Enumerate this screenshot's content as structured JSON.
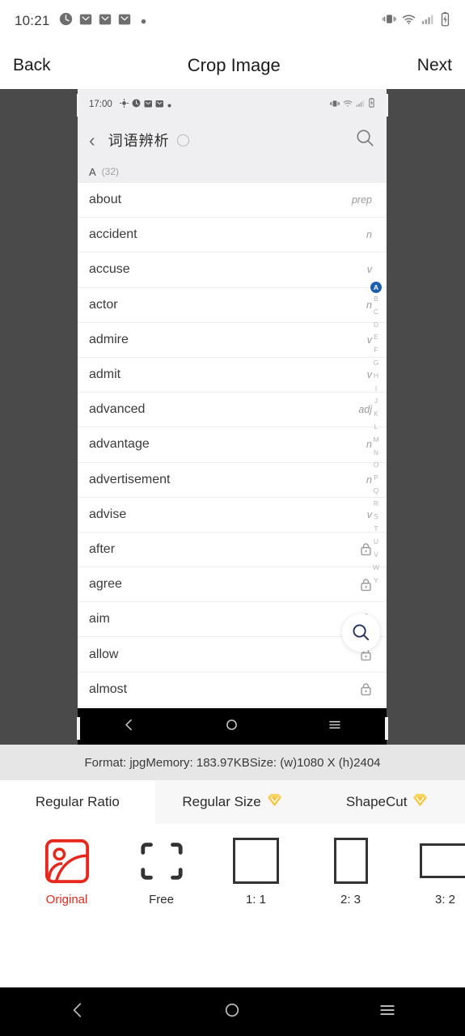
{
  "status_bar": {
    "time": "10:21",
    "left_icons": [
      "clock-icon",
      "mail-icon",
      "mail-icon",
      "mail-icon",
      "dot-icon"
    ],
    "right_icons": [
      "vibrate-icon",
      "wifi-icon",
      "signal-icon",
      "battery-charging-icon"
    ]
  },
  "app_bar": {
    "back_label": "Back",
    "title": "Crop Image",
    "next_label": "Next"
  },
  "preview": {
    "inner_status": {
      "time": "17:00",
      "left_icons": [
        "location-icon",
        "clock-icon",
        "mail-icon",
        "mail-icon",
        "dot-icon"
      ],
      "right_icons": [
        "vibrate-icon",
        "wifi-icon",
        "signal-icon",
        "battery-icon"
      ]
    },
    "inner_title": "词语辨析",
    "section": {
      "letter": "A",
      "count": "(32)"
    },
    "words": [
      {
        "word": "about",
        "pos": "prep",
        "locked": false
      },
      {
        "word": "accident",
        "pos": "n",
        "locked": false
      },
      {
        "word": "accuse",
        "pos": "v",
        "locked": false
      },
      {
        "word": "actor",
        "pos": "n",
        "locked": false
      },
      {
        "word": "admire",
        "pos": "v",
        "locked": false
      },
      {
        "word": "admit",
        "pos": "v",
        "locked": false
      },
      {
        "word": "advanced",
        "pos": "adj",
        "locked": false
      },
      {
        "word": "advantage",
        "pos": "n",
        "locked": false
      },
      {
        "word": "advertisement",
        "pos": "n",
        "locked": false
      },
      {
        "word": "advise",
        "pos": "v",
        "locked": false
      },
      {
        "word": "after",
        "pos": "",
        "locked": true
      },
      {
        "word": "agree",
        "pos": "",
        "locked": true
      },
      {
        "word": "aim",
        "pos": "",
        "locked": true
      },
      {
        "word": "allow",
        "pos": "",
        "locked": true
      },
      {
        "word": "almost",
        "pos": "",
        "locked": true
      }
    ],
    "alphabet": [
      "A",
      "B",
      "C",
      "D",
      "E",
      "F",
      "G",
      "H",
      "I",
      "J",
      "K",
      "L",
      "M",
      "N",
      "O",
      "P",
      "Q",
      "R",
      "S",
      "T",
      "U",
      "V",
      "W",
      "Y"
    ],
    "alphabet_active": "A",
    "fab_icon": "search-icon",
    "nav_icons": [
      "back-icon",
      "home-icon",
      "recents-icon"
    ]
  },
  "info_bar": {
    "text": "Format: jpgMemory: 183.97KBSize: (w)1080 X (h)2404"
  },
  "tabs": [
    {
      "label": "Regular Ratio",
      "active": true,
      "vip": false
    },
    {
      "label": "Regular Size",
      "active": false,
      "vip": true
    },
    {
      "label": "ShapeCut",
      "active": false,
      "vip": true
    }
  ],
  "ratios": [
    {
      "label": "Original",
      "icon": "image-icon",
      "selected": true
    },
    {
      "label": "Free",
      "icon": "corners-icon",
      "selected": false
    },
    {
      "label": "1: 1",
      "icon": "square-icon",
      "selected": false
    },
    {
      "label": "2: 3",
      "icon": "portrait-icon",
      "selected": false
    },
    {
      "label": "3: 2",
      "icon": "landscape-icon",
      "selected": false
    },
    {
      "label": "",
      "icon": "partial-icon",
      "selected": false
    }
  ],
  "bottom_nav": {
    "icons": [
      "back-icon",
      "home-icon",
      "recents-icon"
    ]
  },
  "colors": {
    "accent_red": "#e8271c",
    "index_blue": "#1c5fb0",
    "vip_gold": "#f6c43c",
    "stage_gray": "#4a4a4a"
  }
}
